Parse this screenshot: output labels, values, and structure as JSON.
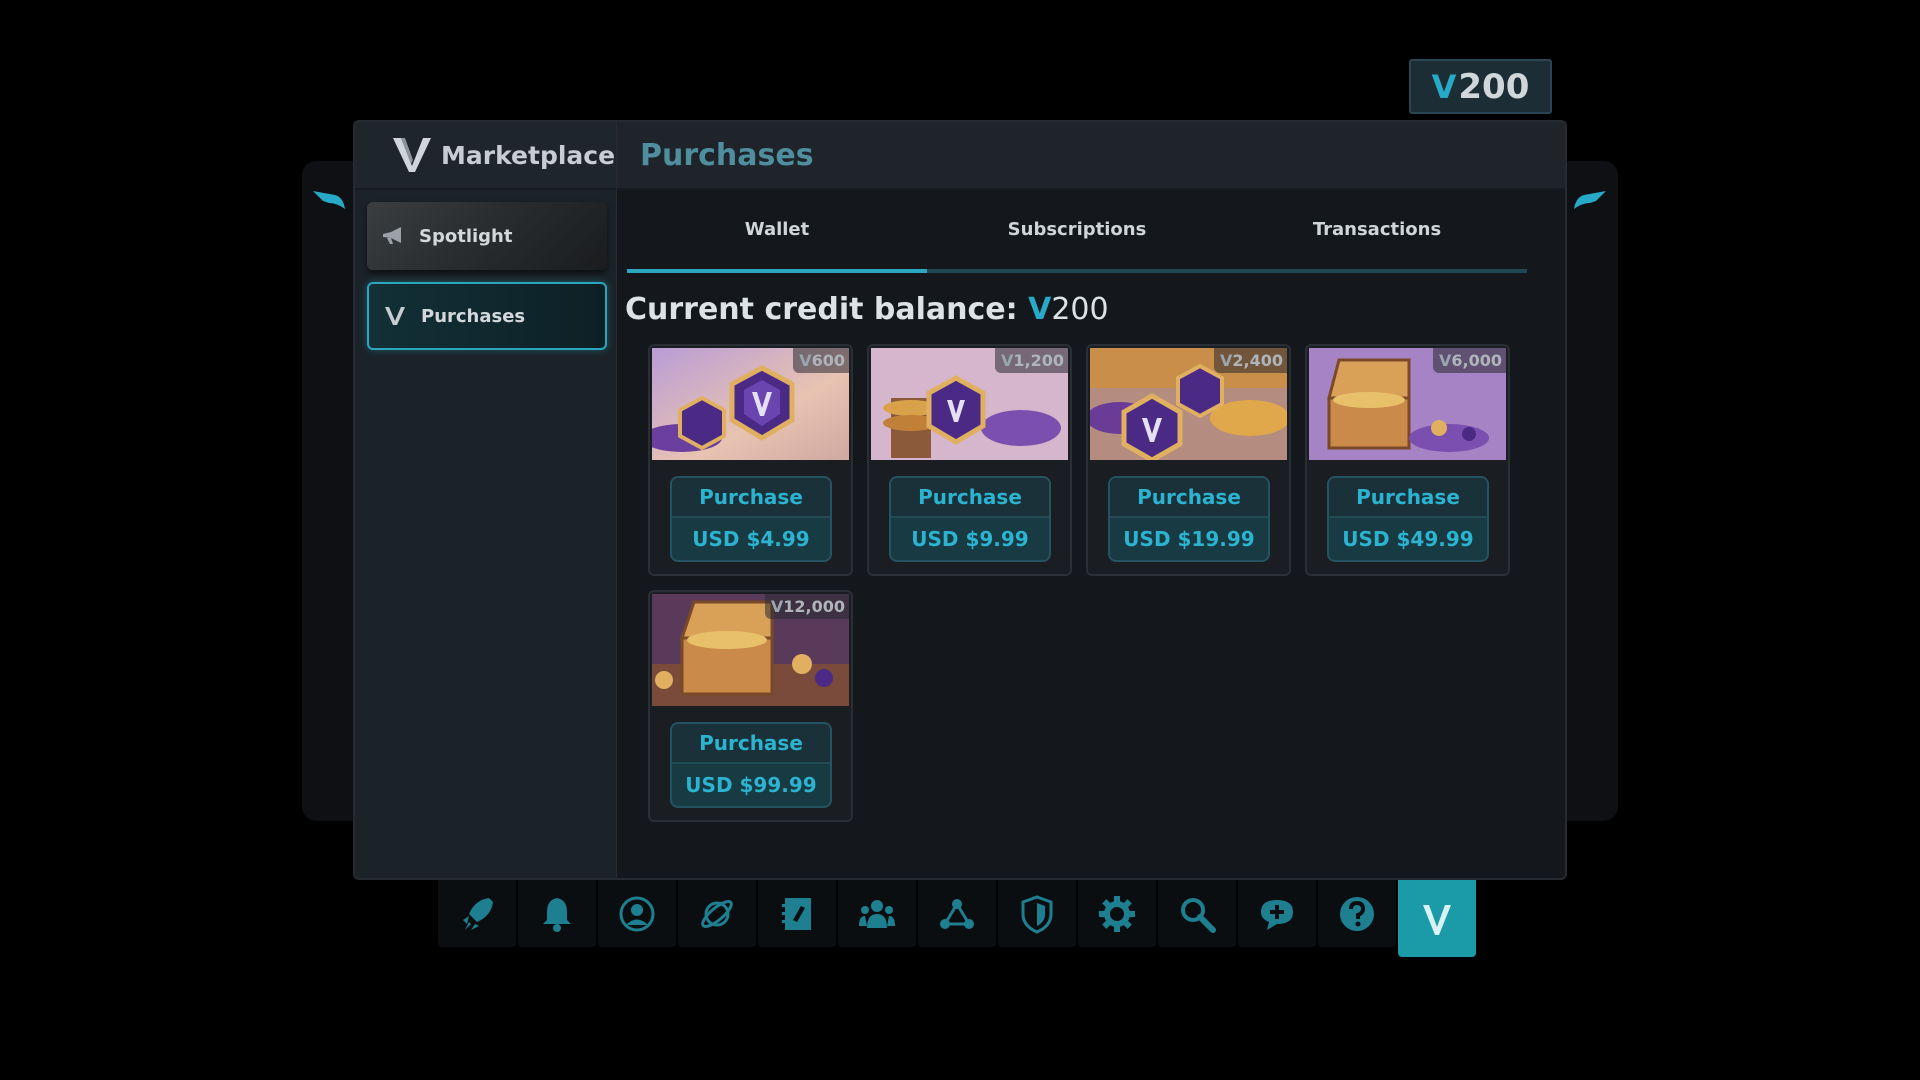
{
  "wallet_pill": {
    "currency_symbol": "V",
    "balance": "200"
  },
  "sidebar": {
    "title": "Marketplace",
    "items": [
      {
        "label": "Spotlight",
        "icon": "megaphone-icon"
      },
      {
        "label": "Purchases",
        "icon": "v-logo-icon",
        "selected": true
      }
    ]
  },
  "main": {
    "title": "Purchases",
    "tabs": [
      {
        "label": "Wallet",
        "active": true
      },
      {
        "label": "Subscriptions"
      },
      {
        "label": "Transactions"
      }
    ],
    "balance_label": "Current credit balance:",
    "balance_symbol": "V",
    "balance_value": "200"
  },
  "packs": [
    {
      "credits": "600",
      "button_label": "Purchase",
      "price": "USD $4.99"
    },
    {
      "credits": "1,200",
      "button_label": "Purchase",
      "price": "USD $9.99"
    },
    {
      "credits": "2,400",
      "button_label": "Purchase",
      "price": "USD $19.99"
    },
    {
      "credits": "6,000",
      "button_label": "Purchase",
      "price": "USD $49.99"
    },
    {
      "credits": "12,000",
      "button_label": "Purchase",
      "price": "USD $99.99"
    }
  ],
  "dock": [
    {
      "icon": "rocket-icon"
    },
    {
      "icon": "bell-icon"
    },
    {
      "icon": "profile-icon"
    },
    {
      "icon": "planet-icon"
    },
    {
      "icon": "journal-icon"
    },
    {
      "icon": "group-icon"
    },
    {
      "icon": "network-icon"
    },
    {
      "icon": "shield-icon"
    },
    {
      "icon": "gear-icon"
    },
    {
      "icon": "search-icon"
    },
    {
      "icon": "chat-add-icon"
    },
    {
      "icon": "help-icon"
    },
    {
      "icon": "v-logo-icon",
      "active": true
    }
  ],
  "colors": {
    "accent": "#2aa6bf",
    "button_text": "#2bb3cf",
    "dock_active": "#1b9aa8",
    "background": "#000000"
  }
}
